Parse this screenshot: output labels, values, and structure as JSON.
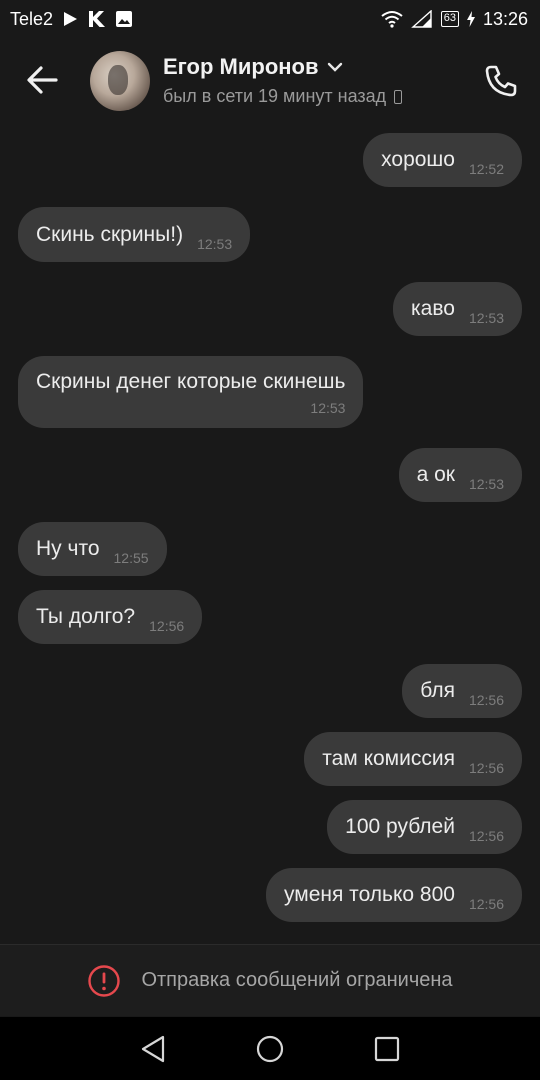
{
  "status_bar": {
    "carrier": "Tele2",
    "battery": "63",
    "clock": "13:26",
    "icons": [
      "play-icon",
      "k-app-icon",
      "image-icon",
      "wifi-icon",
      "signal-icon",
      "battery-icon"
    ]
  },
  "header": {
    "name": "Егор Миронов",
    "status": "был в сети 19 минут назад",
    "icons": [
      "back-arrow-icon",
      "chevron-down-icon",
      "mobile-device-icon",
      "phone-call-icon"
    ]
  },
  "messages": [
    {
      "text": "хорошо",
      "time": "12:52",
      "direction": "out"
    },
    {
      "text": "Скинь скрины!)",
      "time": "12:53",
      "direction": "in"
    },
    {
      "text": "каво",
      "time": "12:53",
      "direction": "out"
    },
    {
      "text": "Скрины денег которые скинешь",
      "time": "12:53",
      "direction": "in"
    },
    {
      "text": "а ок",
      "time": "12:53",
      "direction": "out"
    },
    {
      "text": "Ну что",
      "time": "12:55",
      "direction": "in"
    },
    {
      "text": "Ты долго?",
      "time": "12:56",
      "direction": "in"
    },
    {
      "text": "бля",
      "time": "12:56",
      "direction": "out"
    },
    {
      "text": "там комиссия",
      "time": "12:56",
      "direction": "out"
    },
    {
      "text": "100 рублей",
      "time": "12:56",
      "direction": "out"
    },
    {
      "text": "уменя только 800",
      "time": "12:56",
      "direction": "out"
    }
  ],
  "restriction": {
    "text": "Отправка сообщений ограничена",
    "accent": "#e5484d"
  },
  "nav": {
    "icons": [
      "back-triangle-icon",
      "home-circle-icon",
      "recents-square-icon"
    ]
  }
}
